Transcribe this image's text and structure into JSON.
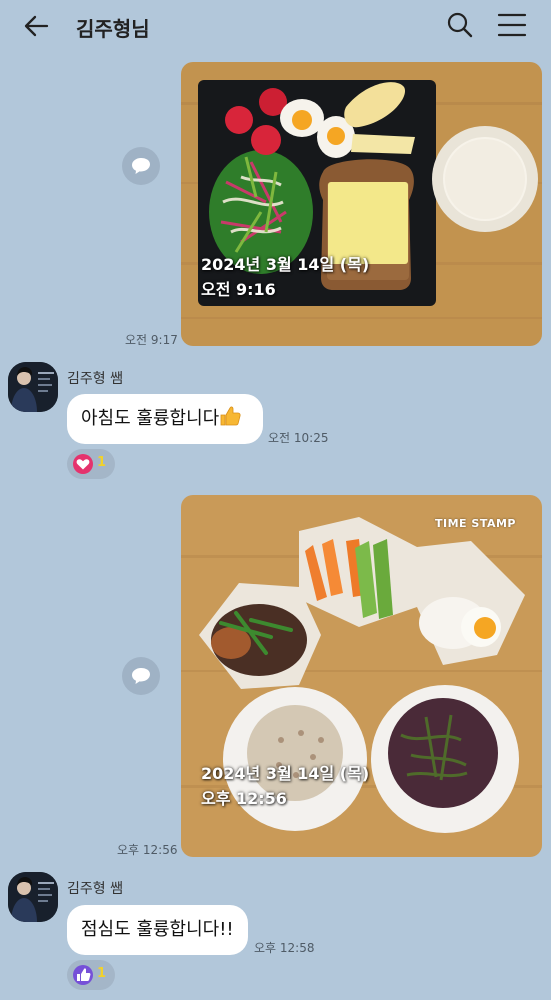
{
  "header": {
    "title": "김주형님",
    "back_icon": "back-arrow-icon",
    "search_icon": "search-icon",
    "menu_icon": "hamburger-menu-icon"
  },
  "messages": [
    {
      "kind": "photo",
      "stamp_date": "2024년 3월 14일 (목)",
      "stamp_time": "오전 9:16",
      "time": "오전 9:17"
    },
    {
      "kind": "text",
      "sender": "김주형 쌤",
      "text": "아침도 훌륭합니다",
      "emoji": "thumbs-up-emoji",
      "time": "오전 10:25",
      "reaction": {
        "icon": "heart-icon",
        "color": "#e5336d",
        "count": "1"
      }
    },
    {
      "kind": "photo",
      "stamp_date": "2024년 3월 14일 (목)",
      "stamp_time": "오후 12:56",
      "watermark": "TIME STAMP",
      "time": "오후 12:56"
    },
    {
      "kind": "text",
      "sender": "김주형 쌤",
      "text": "점심도 훌륭합니다!!",
      "time": "오후 12:58",
      "reaction": {
        "icon": "thumbs-up-icon",
        "color": "#7650d8",
        "count": "1"
      }
    }
  ],
  "colors": {
    "background": "#b2c7da",
    "bubble": "#ffffff",
    "reaction_count": "#f2d22a"
  }
}
